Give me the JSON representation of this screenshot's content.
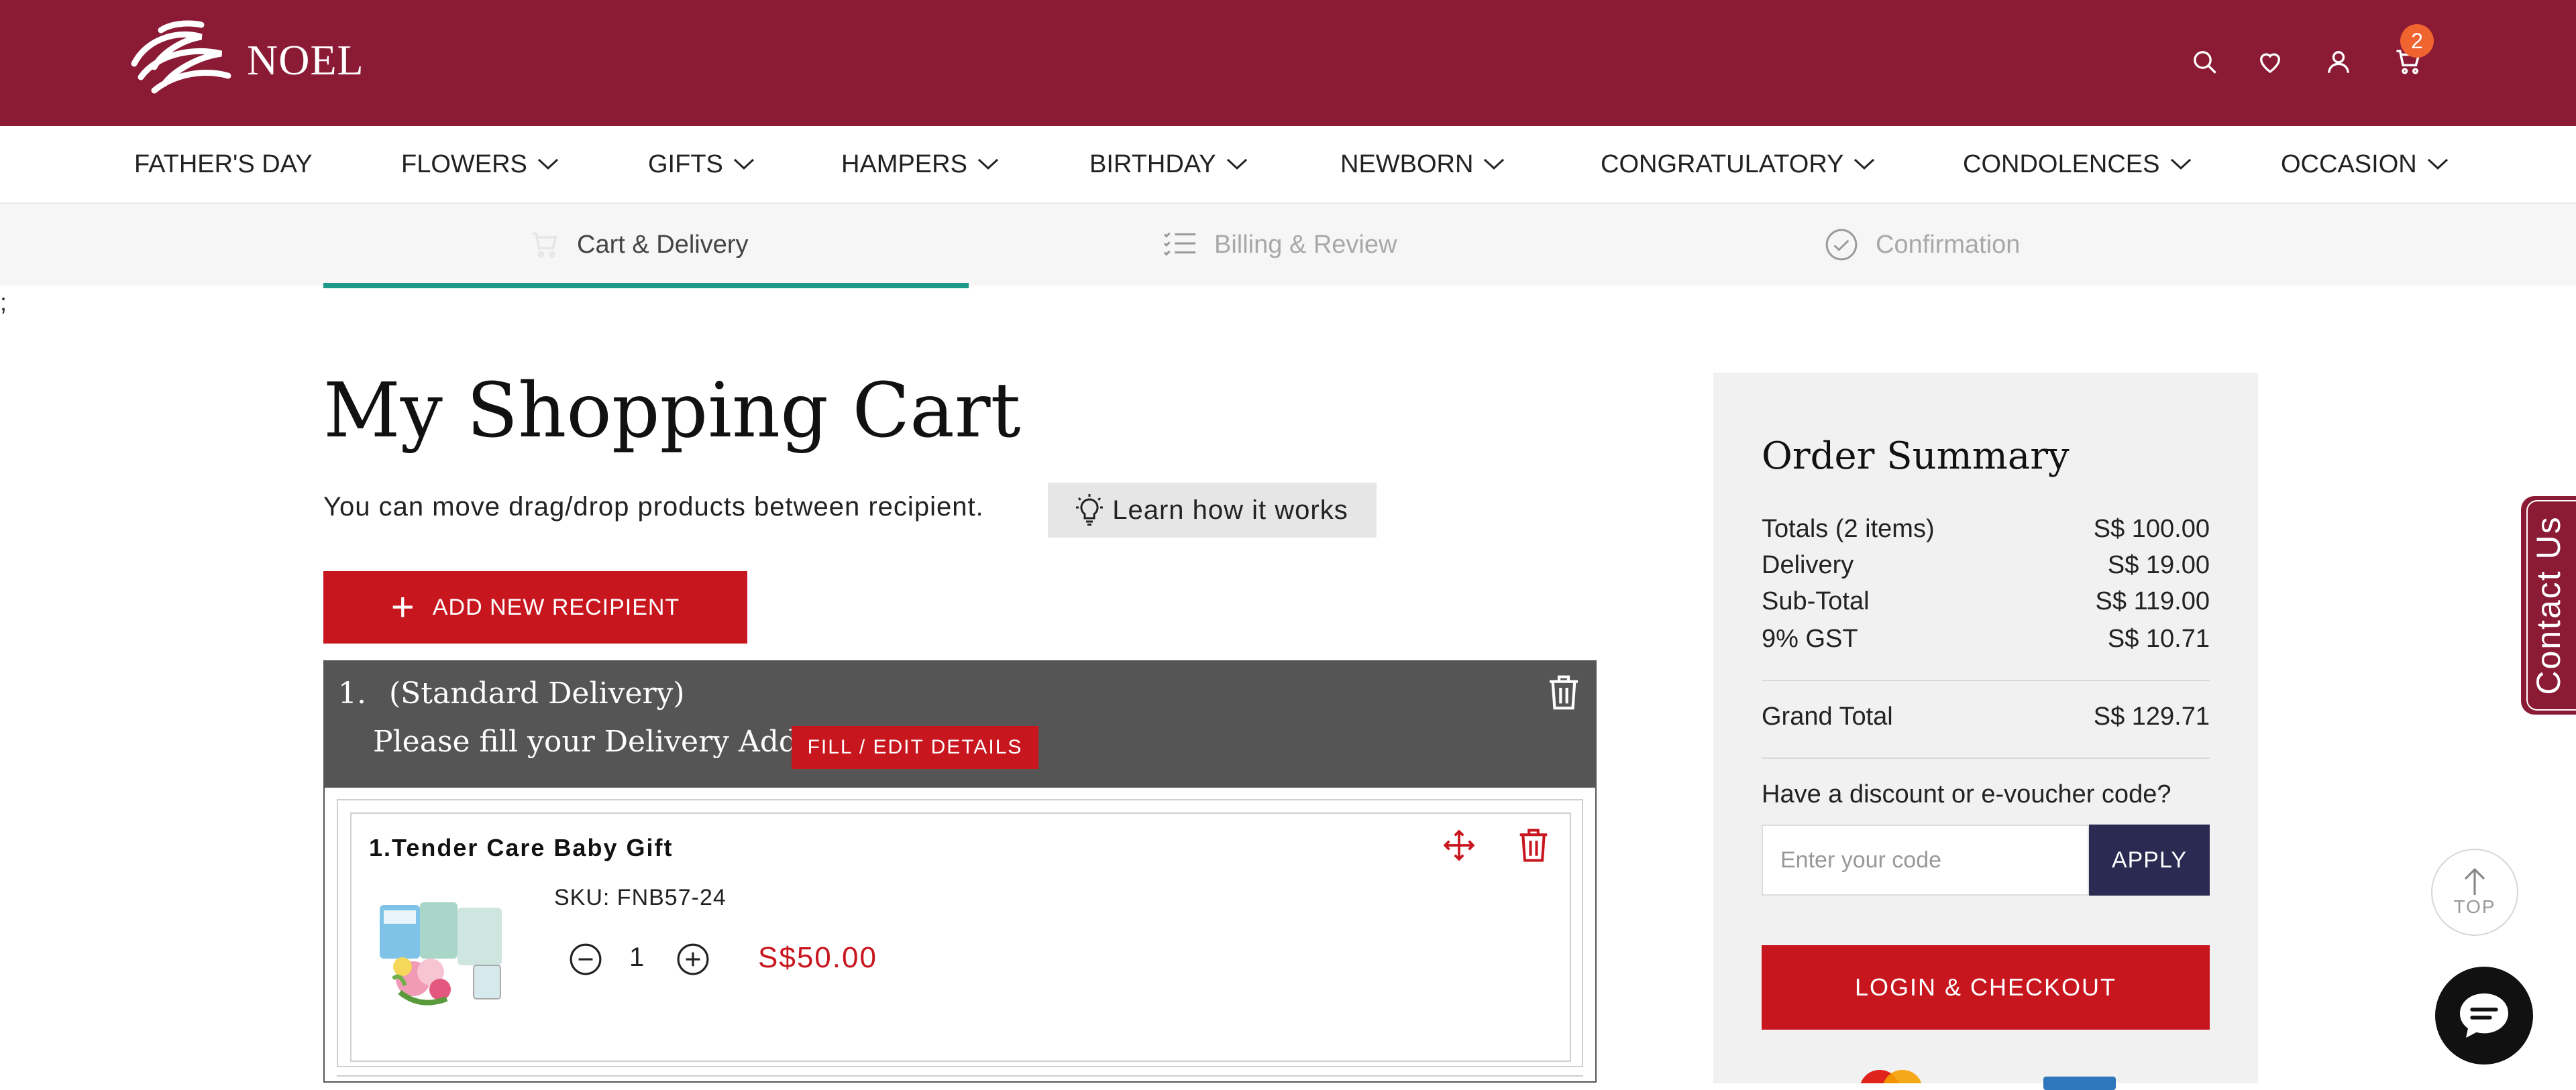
{
  "header": {
    "brand": "NOEL",
    "cart_count": "2"
  },
  "nav": {
    "items": [
      {
        "label": "FATHER'S DAY"
      },
      {
        "label": "FLOWERS"
      },
      {
        "label": "GIFTS"
      },
      {
        "label": "HAMPERS"
      },
      {
        "label": "BIRTHDAY"
      },
      {
        "label": "NEWBORN"
      },
      {
        "label": "CONGRATULATORY"
      },
      {
        "label": "CONDOLENCES"
      },
      {
        "label": "OCCASION"
      }
    ]
  },
  "steps": [
    {
      "label": "Cart & Delivery",
      "state": "active"
    },
    {
      "label": "Billing & Review",
      "state": "inactive"
    },
    {
      "label": "Confirmation",
      "state": "inactive"
    }
  ],
  "stray_text": ";",
  "cart": {
    "title": "My Shopping Cart",
    "drag_note": "You can move drag/drop products between recipient.",
    "learn_label": "Learn how it works",
    "add_recipient_label": "ADD NEW RECIPIENT",
    "recipient": {
      "number": "1.",
      "delivery_type": "(Standard Delivery)",
      "address_prompt": "Please fill your Delivery Address",
      "fill_button": "FILL / EDIT DETAILS"
    },
    "items": [
      {
        "title": "1.Tender Care Baby Gift",
        "sku": "SKU: FNB57-24",
        "quantity": "1",
        "price": "S$50.00"
      }
    ]
  },
  "summary": {
    "title": "Order Summary",
    "rows": [
      {
        "label": "Totals (2 items)",
        "value": "S$ 100.00"
      },
      {
        "label": "Delivery",
        "value": "S$ 19.00"
      },
      {
        "label": "Sub-Total",
        "value": "S$ 119.00"
      },
      {
        "label": "9% GST",
        "value": "S$ 10.71"
      }
    ],
    "grand_total_label": "Grand Total",
    "grand_total_value": "S$ 129.71",
    "discount_question": "Have a discount or e-voucher code?",
    "code_placeholder": "Enter your code",
    "apply_label": "APPLY",
    "checkout_label": "LOGIN & CHECKOUT"
  },
  "floating": {
    "contact_label": "Contact Us",
    "top_label": "TOP"
  },
  "colors": {
    "brand": "#8b1a35",
    "accent_red": "#c8161f",
    "teal": "#1d9a8a",
    "navy": "#2b2a52"
  }
}
